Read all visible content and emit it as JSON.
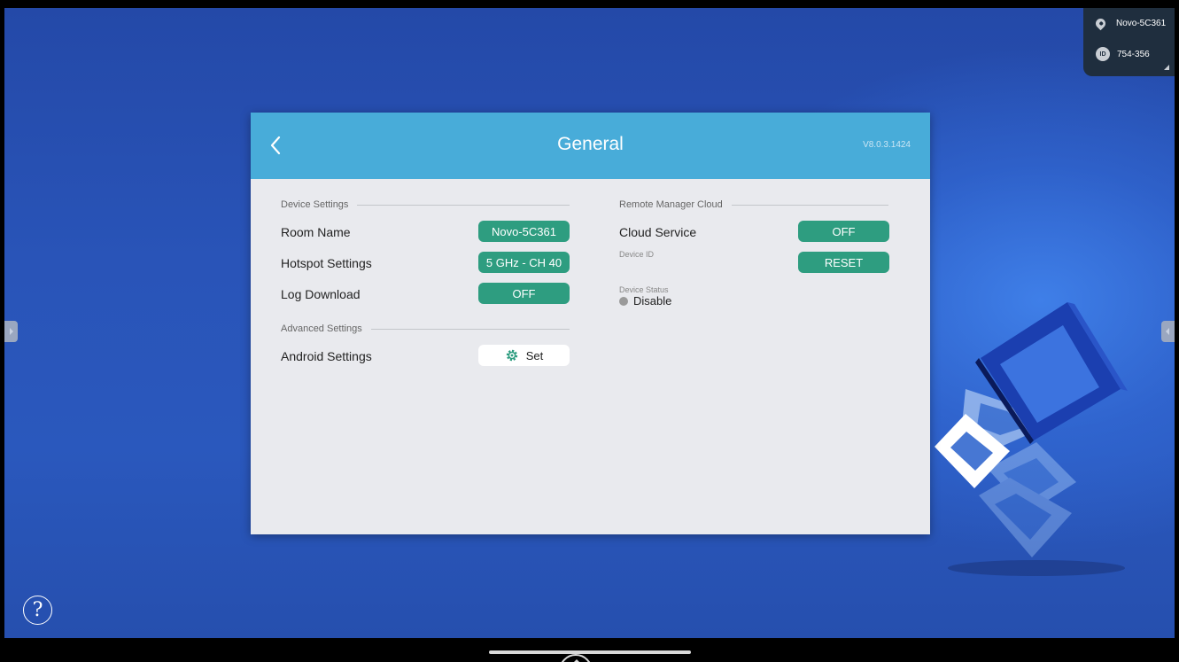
{
  "info_panel": {
    "room_name": "Novo-5C361",
    "id_badge": "ID",
    "id_value": "754-356"
  },
  "dialog": {
    "title": "General",
    "version": "V8.0.3.1424",
    "device_settings": {
      "section_label": "Device Settings",
      "room_name_label": "Room Name",
      "room_name_value": "Novo-5C361",
      "hotspot_label": "Hotspot Settings",
      "hotspot_value": "5 GHz - CH 40",
      "log_download_label": "Log Download",
      "log_download_value": "OFF"
    },
    "advanced_settings": {
      "section_label": "Advanced Settings",
      "android_label": "Android Settings",
      "android_button": "Set"
    },
    "remote_manager": {
      "section_label": "Remote Manager Cloud",
      "cloud_service_label": "Cloud Service",
      "cloud_service_value": "OFF",
      "device_id_label": "Device ID",
      "reset_button": "RESET",
      "device_status_label": "Device Status",
      "device_status_value": "Disable"
    }
  },
  "help_glyph": "?",
  "colors": {
    "header": "#48acd9",
    "pill": "#2e9d80",
    "dialog_bg": "#e9eaee",
    "background": "#2954b8"
  }
}
